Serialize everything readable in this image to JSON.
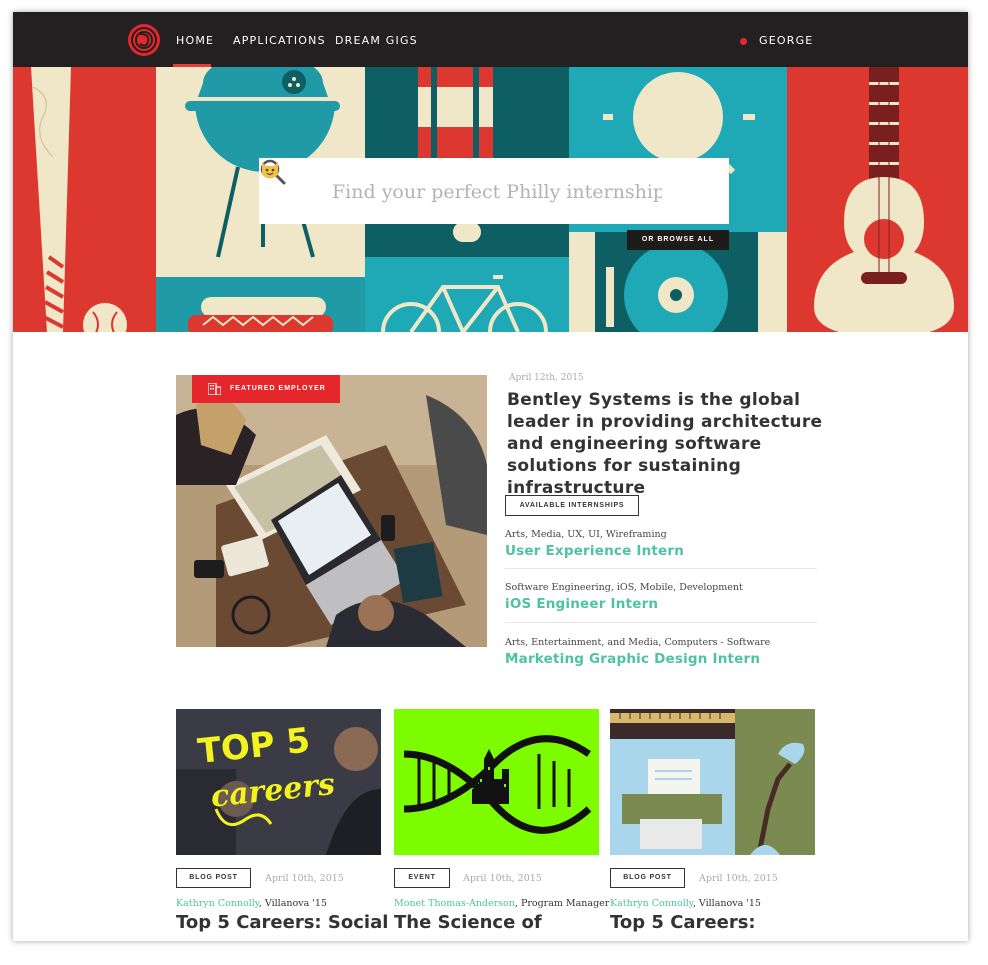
{
  "nav": {
    "items": [
      "HOME",
      "APPLICATIONS",
      "DREAM GIGS"
    ],
    "user": "GEORGE"
  },
  "hero": {
    "search_placeholder": "Find your perfect Philly internship",
    "browse_label": "OR BROWSE ALL"
  },
  "featured": {
    "badge": "FEATURED EMPLOYER",
    "date": "April 12th, 2015",
    "title": "Bentley Systems is the global leader in providing architecture and engineering software solutions for sustaining infrastructure",
    "available_label": "AVAILABLE INTERNSHIPS",
    "jobs": [
      {
        "tags": "Arts, Media, UX, UI, Wireframing",
        "title": "User Experience Intern"
      },
      {
        "tags": "Software Engineering, iOS, Mobile, Development",
        "title": "iOS Engineer Intern"
      },
      {
        "tags": "Arts, Entertainment, and Media, Computers - Software",
        "title": "Marketing Graphic Design Intern"
      }
    ]
  },
  "cards": [
    {
      "type": "BLOG POST",
      "date": "April 10th, 2015",
      "author": "Kathryn Connolly",
      "affiliation": ", Villanova '15",
      "title": "Top 5 Careers: Social"
    },
    {
      "type": "EVENT",
      "date": "April 10th, 2015",
      "author": "Monet Thomas-Anderson",
      "affiliation": ", Program Manager",
      "title": "The Science of"
    },
    {
      "type": "BLOG POST",
      "date": "April 10th, 2015",
      "author": "Kathryn Connolly",
      "affiliation": ", Villanova '15",
      "title": "Top 5 Careers:"
    }
  ],
  "card_art": {
    "careers_text": "TOP 5",
    "careers_script": "careers"
  },
  "colors": {
    "accent": "#e5262b",
    "teal": "#4dc3a1",
    "nav_bg": "#222021"
  }
}
